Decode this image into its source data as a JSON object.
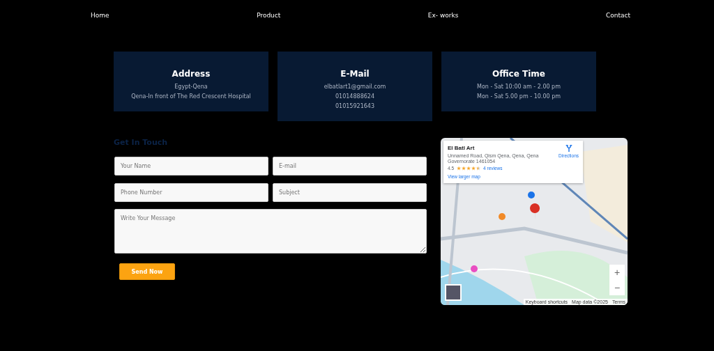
{
  "nav": [
    {
      "label": "Home"
    },
    {
      "label": "Product"
    },
    {
      "label": "Ex- works"
    },
    {
      "label": "Contact"
    }
  ],
  "info_cards": [
    {
      "title": "Address",
      "lines": [
        "Egypt-Qena",
        "Qena-In front of The Red Crescent Hospital"
      ]
    },
    {
      "title": "E-Mail",
      "lines": [
        "elbatlart1@gmail.com",
        "01014888624",
        "01015921643"
      ]
    },
    {
      "title": "Office Time",
      "lines": [
        "Mon - Sat 10:00 am - 2.00 pm",
        "Mon - Sat 5.00 pm - 10.00 pm"
      ]
    }
  ],
  "form": {
    "heading": "Get In Touch",
    "fields": [
      {
        "placeholder": "Your Name"
      },
      {
        "placeholder": "E-mail"
      },
      {
        "placeholder": "Phone Number"
      },
      {
        "placeholder": "Subject"
      }
    ],
    "message": {
      "placeholder": "Write Your Message"
    },
    "button": "Send Now"
  },
  "map": {
    "place_card": {
      "name": "El Batl Art",
      "address": "Unnamed Road, Qism Qena, Qena, Qena Governorate 1461054",
      "rating": "4.5",
      "stars": 4.5,
      "reviews": "4 reviews",
      "directions": "Directions",
      "larger_map": "View larger map"
    },
    "zoom_in": "+",
    "zoom_out": "−",
    "footer": [
      "Keyboard shortcuts",
      "Map data ©2025",
      "Terms"
    ]
  }
}
